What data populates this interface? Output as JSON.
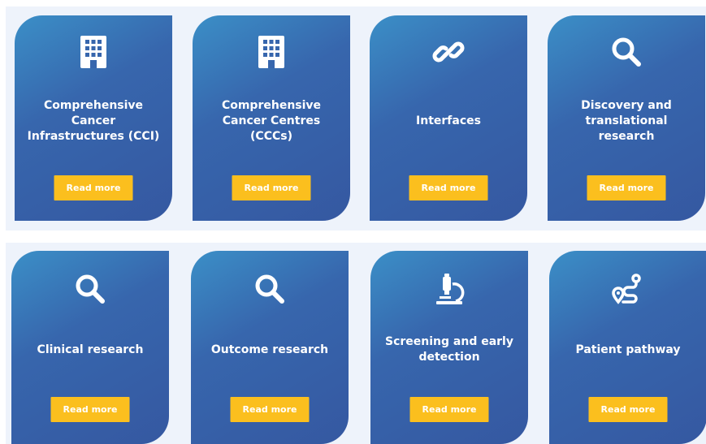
{
  "colors": {
    "panel_bg": "#eef3fb",
    "card_gradient_start": "#3b8fc7",
    "card_gradient_end": "#3558a1",
    "button_bg": "#fbbf1e",
    "text": "#ffffff"
  },
  "cards": [
    {
      "title": "Comprehensive Cancer Infrastructures (CCI)",
      "icon": "building-icon",
      "button": "Read more"
    },
    {
      "title": "Comprehensive Cancer Centres (CCCs)",
      "icon": "building-icon",
      "button": "Read more"
    },
    {
      "title": "Interfaces",
      "icon": "link-icon",
      "button": "Read more"
    },
    {
      "title": "Discovery and translational research",
      "icon": "search-icon",
      "button": "Read more"
    },
    {
      "title": "Clinical research",
      "icon": "search-icon",
      "button": "Read more"
    },
    {
      "title": "Outcome research",
      "icon": "search-icon",
      "button": "Read more"
    },
    {
      "title": "Screening and early detection",
      "icon": "microscope-icon",
      "button": "Read more"
    },
    {
      "title": "Patient pathway",
      "icon": "route-icon",
      "button": "Read more"
    }
  ]
}
